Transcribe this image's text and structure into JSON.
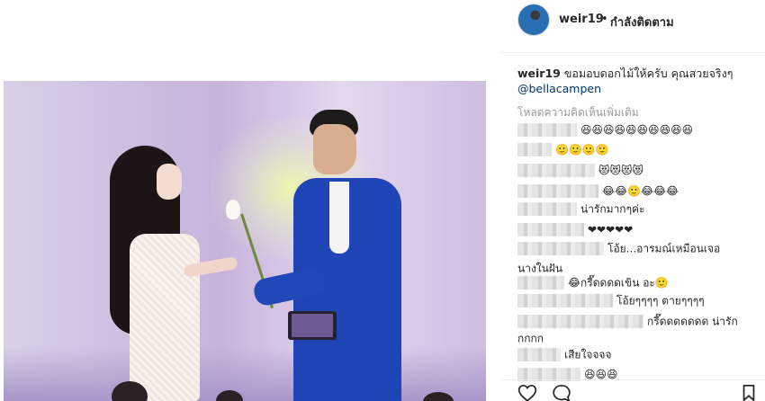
{
  "post": {
    "username": "weir19",
    "separator": "•",
    "follow_status": "กำลังติดตาม",
    "caption": {
      "username": "weir19",
      "text": "ขอมอบดอกไม้ให้ครับ คุณสวยจริงๆ",
      "mention": "@bellacampen"
    },
    "load_more": "โหลดความคิดเห็นเพิ่มเติม"
  },
  "comments": [
    {
      "text": "😆😆😆😆😆😆😆😆😆😆"
    },
    {
      "text": "🙂🙂🙂🙂"
    },
    {
      "text": "😻😻😻😻"
    },
    {
      "text": "😂😂🙂😂😂😂"
    },
    {
      "text": "น่ารักมากๆค่ะ"
    },
    {
      "text": "❤❤❤❤❤"
    },
    {
      "text": "โอ้ย...อารมณ์เหมือนเจอ"
    },
    {
      "text": "นางในฝัน"
    },
    {
      "text": "😂กรี๊ดดดดเขิน อะ🙂"
    },
    {
      "text": "โอ้ยๆๆๆๆ ตายๆๆๆๆ"
    },
    {
      "text": "กรี๊ดดดดดดด น่ารัก"
    },
    {
      "text": "กกกก"
    },
    {
      "text": "เสียใจจจจ"
    },
    {
      "text": "😆😆😆"
    }
  ],
  "icons": {
    "like": "heart-icon",
    "comment": "comment-icon",
    "save": "bookmark-icon"
  }
}
